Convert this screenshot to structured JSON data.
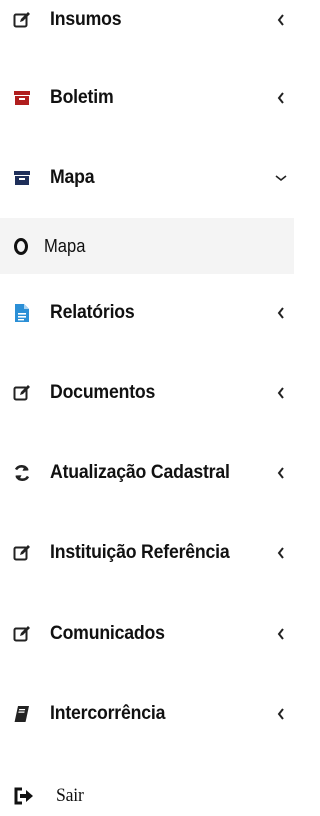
{
  "menu": {
    "items": [
      {
        "label": "Insumos",
        "icon": "edit-icon"
      },
      {
        "label": "Boletim",
        "icon": "archive-box-icon"
      },
      {
        "label": "Mapa",
        "icon": "archive-box-icon"
      },
      {
        "label": "Relatórios",
        "icon": "document-icon"
      },
      {
        "label": "Documentos",
        "icon": "edit-icon"
      },
      {
        "label": "Atualização Cadastral",
        "icon": "refresh-icon"
      },
      {
        "label": "Instituição Referência",
        "icon": "edit-icon"
      },
      {
        "label": "Comunicados",
        "icon": "edit-icon"
      },
      {
        "label": "Intercorrência",
        "icon": "book-icon"
      }
    ],
    "submenu": {
      "label": "Mapa",
      "icon": "circle-icon"
    },
    "logout": {
      "label": "Sair",
      "icon": "sign-out-icon"
    }
  },
  "colors": {
    "boletim_icon": "#b01e1e",
    "mapa_icon": "#1f2f5a",
    "relatorios_icon": "#2b8fd6",
    "text": "#111111",
    "submenu_bg": "#f4f4f4"
  }
}
